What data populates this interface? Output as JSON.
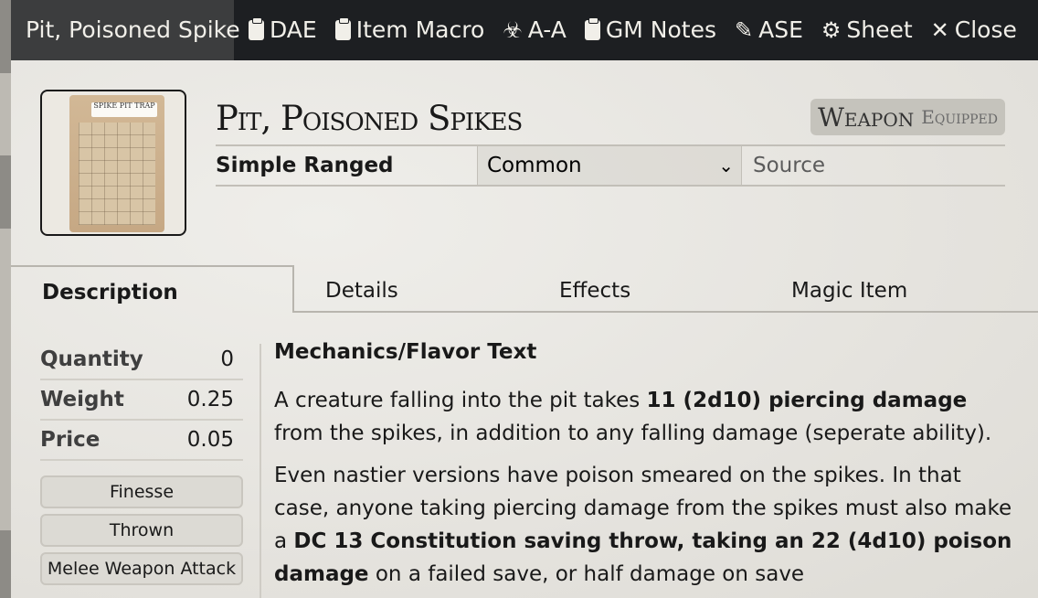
{
  "header": {
    "title": "Pit, Poisoned Spike",
    "controls": [
      {
        "label": "DAE",
        "icon": "clipboard-icon"
      },
      {
        "label": "Item Macro",
        "icon": "sd-card-icon"
      },
      {
        "label": "A-A",
        "icon": "biohazard-icon"
      },
      {
        "label": "GM Notes",
        "icon": "clipboard-icon"
      },
      {
        "label": "ASE",
        "icon": "magic-wand-icon"
      },
      {
        "label": "Sheet",
        "icon": "gear-icon"
      },
      {
        "label": "Close",
        "icon": "close-icon"
      }
    ]
  },
  "item": {
    "name": "Pit, Poisoned Spikes",
    "portrait_label": "SPIKE PIT TRAP",
    "badge_main": "Weapon",
    "badge_sub": "Equipped",
    "type": "Simple Ranged",
    "rarity": "Common",
    "source_placeholder": "Source"
  },
  "tabs": [
    "Description",
    "Details",
    "Effects",
    "Magic Item"
  ],
  "sidebar": {
    "stats": [
      {
        "label": "Quantity",
        "value": "0"
      },
      {
        "label": "Weight",
        "value": "0.25"
      },
      {
        "label": "Price",
        "value": "0.05"
      }
    ],
    "properties": [
      "Finesse",
      "Thrown",
      "Melee Weapon Attack"
    ]
  },
  "description": {
    "heading": "Mechanics/Flavor Text",
    "p1_a": "A creature falling into the pit takes ",
    "p1_b": "11 (2d10) piercing damage",
    "p1_c": " from the spikes, in addition to any falling damage (seperate ability).",
    "p2_a": "Even nastier versions have poison smeared on the spikes. In that case, anyone taking piercing damage from the spikes must also make a ",
    "p2_b": "DC 13 Constitution saving throw, taking an 22 (4d10) poison damage",
    "p2_c": " on a failed save, or half damage on save"
  }
}
